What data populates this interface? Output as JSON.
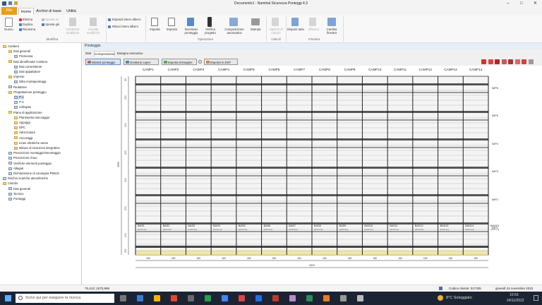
{
  "window": {
    "title": "Documento1 - Namirial Sicurezza Ponteggi 4.3"
  },
  "menu_tabs": [
    "File",
    "Home",
    "Archivi di base",
    "Utilità"
  ],
  "ribbon": {
    "nuovo": "Nuovo",
    "elimina": "Elimina",
    "duplica": "Duplica",
    "rinomina": "Rinomina",
    "sposta_su": "Sposta su",
    "sposta_giu": "Sposta giù",
    "conferma": "Conferma modifiche",
    "annulla": "Annulla modifiche",
    "espandi": "Espandi intero albero",
    "riduci": "Riduci intero albero",
    "importa": "Importa",
    "esporta": "Esporta",
    "inventario": "Inventario ponteggio",
    "verifica": "Verifica progetto",
    "composizione": "Composizione automatica",
    "stampa": "Stampa",
    "opzioni": "Opzioni di calcolo",
    "disponi": "Disponi tutto",
    "affianca": "Affianca",
    "cambia": "Cambia finestra",
    "group_modifica": "Modifica",
    "group_operazioni": "Operazioni",
    "group_calcoli": "Calcoli",
    "group_finestra": "Finestra"
  },
  "tree": [
    {
      "label": "Cantiere",
      "level": 0,
      "icon": "folder"
    },
    {
      "label": "Dati generali",
      "level": 1,
      "icon": "folder"
    },
    {
      "label": "Premessa",
      "level": 2,
      "icon": "doc"
    },
    {
      "label": "Dati identificativi Cantiere",
      "level": 1,
      "icon": "folder"
    },
    {
      "label": "Dati committente",
      "level": 2,
      "icon": "doc"
    },
    {
      "label": "Dati appaltatore",
      "level": 2,
      "icon": "doc"
    },
    {
      "label": "Imprese",
      "level": 1,
      "icon": "folder"
    },
    {
      "label": "Ditta montaponteggi",
      "level": 2,
      "icon": "doc"
    },
    {
      "label": "Redattore",
      "level": 1,
      "icon": "doc"
    },
    {
      "label": "Progettazione ponteggio",
      "level": 1,
      "icon": "folder"
    },
    {
      "label": "P-1",
      "level": 2,
      "icon": "doc"
    },
    {
      "label": "P-2",
      "level": 2,
      "icon": "doc"
    },
    {
      "label": "collegato",
      "level": 2,
      "icon": "doc"
    },
    {
      "label": "Piano di applicazione",
      "level": 1,
      "icon": "folder"
    },
    {
      "label": "Planimetria stoccaggio",
      "level": 2,
      "icon": "folder"
    },
    {
      "label": "Appoggi",
      "level": 2,
      "icon": "folder"
    },
    {
      "label": "DPC",
      "level": 2,
      "icon": "folder"
    },
    {
      "label": "Attrezzature",
      "level": 2,
      "icon": "folder"
    },
    {
      "label": "Ancoraggi",
      "level": 2,
      "icon": "folder"
    },
    {
      "label": "Linee elettriche aeree",
      "level": 2,
      "icon": "folder"
    },
    {
      "label": "Misure di sicurezza integrative",
      "level": 2,
      "icon": "folder"
    },
    {
      "label": "Prescrizioni montaggio/smontaggio",
      "level": 1,
      "icon": "doc"
    },
    {
      "label": "Prescrizioni d'uso",
      "level": 1,
      "icon": "doc"
    },
    {
      "label": "Verifiche elementi ponteggio",
      "level": 1,
      "icon": "doc"
    },
    {
      "label": "Allegati",
      "level": 1,
      "icon": "doc"
    },
    {
      "label": "Dichiarazione di consegna PiMUS",
      "level": 1,
      "icon": "doc"
    },
    {
      "label": "Rischio scariche atmosferiche",
      "level": 0,
      "icon": "doc"
    },
    {
      "label": "Calcolo",
      "level": 0,
      "icon": "folder"
    },
    {
      "label": "Dati generali",
      "level": 1,
      "icon": "doc"
    },
    {
      "label": "Tecnico",
      "level": 1,
      "icon": "doc"
    },
    {
      "label": "Ponteggi",
      "level": 1,
      "icon": "doc"
    }
  ],
  "panel": {
    "title": "Ponteggio",
    "subtabs": [
      "Dati",
      "Composizione",
      "Disegno esecutivo"
    ],
    "toolbar": {
      "wizard": "Wizard ponteggio",
      "layer": "Gestione Layer",
      "export_img": "Esporta immagine",
      "export_dxf": "Esporta in DXF"
    }
  },
  "drawing": {
    "columns": [
      "CAMP1",
      "CAMP2",
      "CAMP3",
      "CAMP4",
      "CAMP5",
      "CAMP6",
      "CAMP7",
      "CAMP8",
      "CAMP9",
      "CAMP10",
      "CAMP11",
      "CAMP12",
      "CAMP13",
      "CAMP14"
    ],
    "bays": [
      "BAS1",
      "BAS2",
      "BAS3",
      "BAS4",
      "BAS5",
      "BAS6",
      "BAS7",
      "BAS8",
      "BAS9",
      "BAS10",
      "BAS11",
      "BAS12",
      "BAS13",
      "BAS14",
      "BAS15"
    ],
    "bay_sub": [
      "(H=0 cm)",
      "(H=0 cm)",
      "(H=0 cm)",
      "(H=0 cm)",
      "(H=0 cm)",
      "(H=0 cm)",
      "(H=0 cm)",
      "(H=0 cm)",
      "(H=0 cm)",
      "(H=0 cm)",
      "(H=0 cm)",
      "(H=0 cm)",
      "(H=0 cm)",
      "(H=0 cm)",
      "(H=0 cm)"
    ],
    "level_labels": [
      "IMP6",
      "IMP5",
      "IMP4",
      "IMP3",
      "IMP2",
      "IMP1"
    ],
    "vertical_dims": [
      "93",
      "200",
      "200",
      "200",
      "200",
      "200",
      "200",
      "200"
    ],
    "total_height": "1593",
    "horizontal_dims": [
      "180",
      "180",
      "180",
      "180",
      "180",
      "180",
      "180",
      "180",
      "180",
      "180",
      "180",
      "180",
      "180",
      "180"
    ],
    "total_width": "2520"
  },
  "status": {
    "coords": "75,413; 1070,996",
    "codice": "Codice cliente: 017335",
    "date": "giovedì 24 novembre 2022"
  },
  "taskbar": {
    "search_placeholder": "Scrivi qui per eseguire la ricerca",
    "weather": "8°C Soleggiato",
    "time": "10:53",
    "date": "24/11/2022"
  }
}
